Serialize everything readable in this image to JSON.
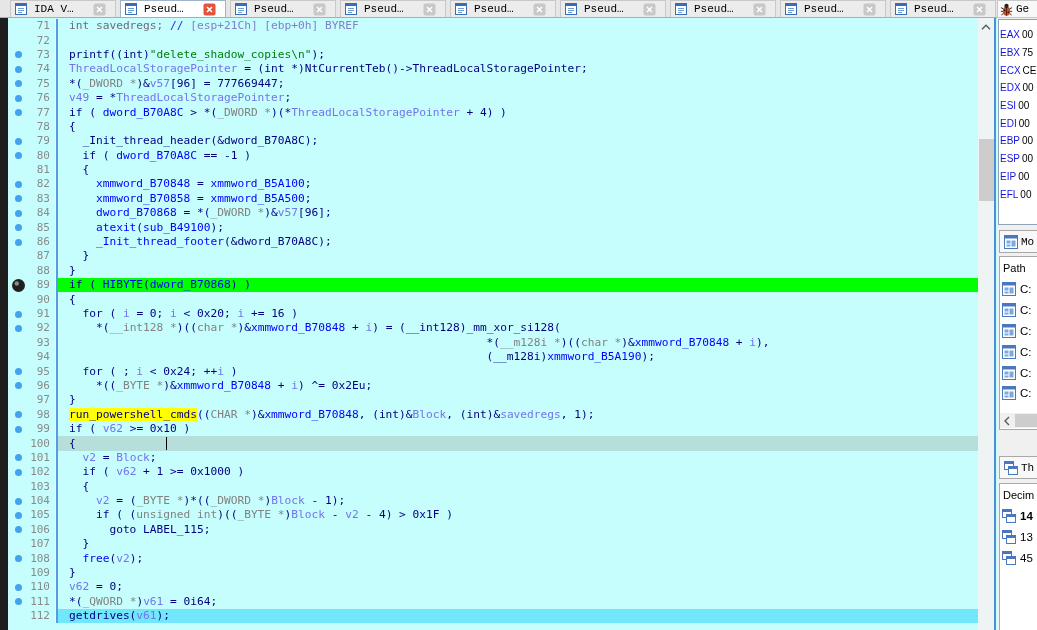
{
  "tabs": [
    {
      "label": "IDA V…",
      "selected": false
    },
    {
      "label": "Pseud…",
      "selected": true
    },
    {
      "label": "Pseud…",
      "selected": false
    },
    {
      "label": "Pseud…",
      "selected": false
    },
    {
      "label": "Pseud…",
      "selected": false
    },
    {
      "label": "Pseud…",
      "selected": false
    },
    {
      "label": "Pseud…",
      "selected": false
    },
    {
      "label": "Pseud…",
      "selected": false
    },
    {
      "label": "Pseud…",
      "selected": false
    }
  ],
  "code": {
    "lines": [
      {
        "number": "71",
        "dot": false,
        "kind": "plain",
        "tokens": [
          {
            "kind": "declaration",
            "text": "int savedregs; "
          },
          {
            "kind": "slashes",
            "text": "// "
          },
          {
            "kind": "comment",
            "text": "[esp+21Ch] [ebp+0h] BYREF"
          }
        ]
      },
      {
        "number": "72",
        "dot": false,
        "kind": "plain"
      },
      {
        "number": "73",
        "dot": true,
        "kind": "plain",
        "tokens": [
          {
            "kind": "plain",
            "text": "printf((int)"
          },
          {
            "kind": "string",
            "text": "\"delete_shadow_copies\\n\""
          },
          {
            "kind": "plain",
            "text": ");"
          }
        ]
      },
      {
        "number": "74",
        "dot": true,
        "kind": "plain",
        "tokens": [
          {
            "kind": "var",
            "text": "ThreadLocalStoragePointer"
          },
          {
            "kind": "plain",
            "text": " = (int *)NtCurrentTeb()->ThreadLocalStoragePointer;"
          }
        ]
      },
      {
        "number": "75",
        "dot": true,
        "kind": "plain",
        "tokens": [
          {
            "kind": "plain",
            "text": "*("
          },
          {
            "kind": "type",
            "text": "_DWORD *"
          },
          {
            "kind": "plain",
            "text": ")&"
          },
          {
            "kind": "var",
            "text": "v57"
          },
          {
            "kind": "plain",
            "text": "[96] = 777669447;"
          }
        ]
      },
      {
        "number": "76",
        "dot": true,
        "kind": "plain",
        "tokens": [
          {
            "kind": "var",
            "text": "v49"
          },
          {
            "kind": "plain",
            "text": " = *"
          },
          {
            "kind": "var",
            "text": "ThreadLocalStoragePointer"
          },
          {
            "kind": "plain",
            "text": ";"
          }
        ]
      },
      {
        "number": "77",
        "dot": true,
        "kind": "plain",
        "tokens": [
          {
            "kind": "plain",
            "text": "if ( "
          },
          {
            "kind": "global",
            "text": "dword_B70A8C"
          },
          {
            "kind": "plain",
            "text": " > *("
          },
          {
            "kind": "type",
            "text": "_DWORD *"
          },
          {
            "kind": "plain",
            "text": ")(*"
          },
          {
            "kind": "var",
            "text": "ThreadLocalStoragePointer"
          },
          {
            "kind": "plain",
            "text": " + 4) )"
          }
        ]
      },
      {
        "number": "78",
        "dot": false,
        "kind": "plain",
        "tokens": [
          {
            "kind": "plain",
            "text": "{"
          }
        ]
      },
      {
        "number": "79",
        "dot": true,
        "kind": "plain",
        "tokens": [
          {
            "kind": "plain",
            "text": "  _Init_thread_header(&dword_B70A8C);"
          }
        ]
      },
      {
        "number": "80",
        "dot": true,
        "kind": "plain",
        "tokens": [
          {
            "kind": "plain",
            "text": "  if ( "
          },
          {
            "kind": "global",
            "text": "dword_B70A8C"
          },
          {
            "kind": "plain",
            "text": " == -1 )"
          }
        ]
      },
      {
        "number": "81",
        "dot": false,
        "kind": "plain",
        "tokens": [
          {
            "kind": "plain",
            "text": "  {"
          }
        ]
      },
      {
        "number": "82",
        "dot": true,
        "kind": "plain",
        "tokens": [
          {
            "kind": "global",
            "text": "    xmmword_B70848"
          },
          {
            "kind": "plain",
            "text": " = "
          },
          {
            "kind": "global",
            "text": "xmmword_B5A100"
          },
          {
            "kind": "plain",
            "text": ";"
          }
        ]
      },
      {
        "number": "83",
        "dot": true,
        "kind": "plain",
        "tokens": [
          {
            "kind": "global",
            "text": "    xmmword_B70858"
          },
          {
            "kind": "plain",
            "text": " = "
          },
          {
            "kind": "global",
            "text": "xmmword_B5A500"
          },
          {
            "kind": "plain",
            "text": ";"
          }
        ]
      },
      {
        "number": "84",
        "dot": true,
        "kind": "plain",
        "tokens": [
          {
            "kind": "global",
            "text": "    dword_B70868"
          },
          {
            "kind": "plain",
            "text": " = *("
          },
          {
            "kind": "type",
            "text": "_DWORD *"
          },
          {
            "kind": "plain",
            "text": ")&"
          },
          {
            "kind": "var",
            "text": "v57"
          },
          {
            "kind": "plain",
            "text": "[96];"
          }
        ]
      },
      {
        "number": "85",
        "dot": true,
        "kind": "plain",
        "tokens": [
          {
            "kind": "global",
            "text": "    atexit"
          },
          {
            "kind": "plain",
            "text": "("
          },
          {
            "kind": "global",
            "text": "sub_B49100"
          },
          {
            "kind": "plain",
            "text": ");"
          }
        ]
      },
      {
        "number": "86",
        "dot": true,
        "kind": "plain",
        "tokens": [
          {
            "kind": "global",
            "text": "    _Init_thread_footer"
          },
          {
            "kind": "plain",
            "text": "(&dword_B70A8C);"
          }
        ]
      },
      {
        "number": "87",
        "dot": false,
        "kind": "plain",
        "tokens": [
          {
            "kind": "plain",
            "text": "  }"
          }
        ]
      },
      {
        "number": "88",
        "dot": false,
        "kind": "plain",
        "tokens": [
          {
            "kind": "plain",
            "text": "}"
          }
        ]
      },
      {
        "number": "89",
        "dot": false,
        "kind": "breakpoint",
        "tokens": [
          {
            "kind": "plain",
            "text": "if ( "
          },
          {
            "kind": "global",
            "text": "HIBYTE"
          },
          {
            "kind": "plain",
            "text": "("
          },
          {
            "kind": "global",
            "text": "dword_B70868"
          },
          {
            "kind": "plain",
            "text": ") )"
          }
        ]
      },
      {
        "number": "90",
        "dot": false,
        "kind": "plain",
        "tokens": [
          {
            "kind": "plain",
            "text": "{"
          }
        ]
      },
      {
        "number": "91",
        "dot": true,
        "kind": "plain",
        "tokens": [
          {
            "kind": "plain",
            "text": "  for ( "
          },
          {
            "kind": "var",
            "text": "i"
          },
          {
            "kind": "plain",
            "text": " = 0; "
          },
          {
            "kind": "var",
            "text": "i"
          },
          {
            "kind": "plain",
            "text": " < 0x20; "
          },
          {
            "kind": "var",
            "text": "i"
          },
          {
            "kind": "plain",
            "text": " += 16 )"
          }
        ]
      },
      {
        "number": "92",
        "dot": true,
        "kind": "plain",
        "tokens": [
          {
            "kind": "plain",
            "text": "    *("
          },
          {
            "kind": "type",
            "text": "__int128 *"
          },
          {
            "kind": "plain",
            "text": ")(("
          },
          {
            "kind": "type",
            "text": "char *"
          },
          {
            "kind": "plain",
            "text": ")&"
          },
          {
            "kind": "global",
            "text": "xmmword_B70848"
          },
          {
            "kind": "plain",
            "text": " + "
          },
          {
            "kind": "var",
            "text": "i"
          },
          {
            "kind": "plain",
            "text": ") = (__int128)_mm_xor_si128("
          }
        ]
      },
      {
        "number": "93",
        "dot": false,
        "kind": "plain",
        "tokens": [
          {
            "kind": "plain",
            "text": "                                                              *("
          },
          {
            "kind": "type",
            "text": "__m128i *"
          },
          {
            "kind": "plain",
            "text": ")(("
          },
          {
            "kind": "type",
            "text": "char *"
          },
          {
            "kind": "plain",
            "text": ")&"
          },
          {
            "kind": "global",
            "text": "xmmword_B70848"
          },
          {
            "kind": "plain",
            "text": " + "
          },
          {
            "kind": "var",
            "text": "i"
          },
          {
            "kind": "plain",
            "text": "),"
          }
        ]
      },
      {
        "number": "94",
        "dot": false,
        "kind": "plain",
        "tokens": [
          {
            "kind": "plain",
            "text": "                                                              (__m128i)"
          },
          {
            "kind": "global",
            "text": "xmmword_B5A190"
          },
          {
            "kind": "plain",
            "text": ");"
          }
        ]
      },
      {
        "number": "95",
        "dot": true,
        "kind": "plain",
        "tokens": [
          {
            "kind": "plain",
            "text": "  for ( ; "
          },
          {
            "kind": "var",
            "text": "i"
          },
          {
            "kind": "plain",
            "text": " < 0x24; ++"
          },
          {
            "kind": "var",
            "text": "i"
          },
          {
            "kind": "plain",
            "text": " )"
          }
        ]
      },
      {
        "number": "96",
        "dot": true,
        "kind": "plain",
        "tokens": [
          {
            "kind": "plain",
            "text": "    *(("
          },
          {
            "kind": "type",
            "text": "_BYTE *"
          },
          {
            "kind": "plain",
            "text": ")&"
          },
          {
            "kind": "global",
            "text": "xmmword_B70848"
          },
          {
            "kind": "plain",
            "text": " + "
          },
          {
            "kind": "var",
            "text": "i"
          },
          {
            "kind": "plain",
            "text": ") ^= 0x2Eu;"
          }
        ]
      },
      {
        "number": "97",
        "dot": false,
        "kind": "plain",
        "tokens": [
          {
            "kind": "plain",
            "text": "}"
          }
        ]
      },
      {
        "number": "98",
        "dot": true,
        "kind": "plain",
        "tokens": [
          {
            "kind": "marked",
            "text": "run_powershell_cmds"
          },
          {
            "kind": "plain",
            "text": "(("
          },
          {
            "kind": "type",
            "text": "CHAR *"
          },
          {
            "kind": "plain",
            "text": ")&"
          },
          {
            "kind": "global",
            "text": "xmmword_B70848"
          },
          {
            "kind": "plain",
            "text": ", (int)&"
          },
          {
            "kind": "var",
            "text": "Block"
          },
          {
            "kind": "plain",
            "text": ", (int)&"
          },
          {
            "kind": "var",
            "text": "savedregs"
          },
          {
            "kind": "plain",
            "text": ", 1);"
          }
        ]
      },
      {
        "number": "99",
        "dot": true,
        "kind": "plain",
        "tokens": [
          {
            "kind": "plain",
            "text": "if ( "
          },
          {
            "kind": "var",
            "text": "v62"
          },
          {
            "kind": "plain",
            "text": " >= 0x10 )"
          }
        ]
      },
      {
        "number": "100",
        "dot": false,
        "kind": "cursor",
        "tokens": [
          {
            "kind": "plain",
            "text": "{"
          }
        ]
      },
      {
        "number": "101",
        "dot": true,
        "kind": "plain",
        "tokens": [
          {
            "kind": "var",
            "text": "  v2"
          },
          {
            "kind": "plain",
            "text": " = "
          },
          {
            "kind": "var",
            "text": "Block"
          },
          {
            "kind": "plain",
            "text": ";"
          }
        ]
      },
      {
        "number": "102",
        "dot": true,
        "kind": "plain",
        "tokens": [
          {
            "kind": "plain",
            "text": "  if ( "
          },
          {
            "kind": "var",
            "text": "v62"
          },
          {
            "kind": "plain",
            "text": " + 1 >= 0x1000 )"
          }
        ]
      },
      {
        "number": "103",
        "dot": false,
        "kind": "plain",
        "tokens": [
          {
            "kind": "plain",
            "text": "  {"
          }
        ]
      },
      {
        "number": "104",
        "dot": true,
        "kind": "plain",
        "tokens": [
          {
            "kind": "var",
            "text": "    v2"
          },
          {
            "kind": "plain",
            "text": " = ("
          },
          {
            "kind": "type",
            "text": "_BYTE *"
          },
          {
            "kind": "plain",
            "text": ")*(("
          },
          {
            "kind": "type",
            "text": "_DWORD *"
          },
          {
            "kind": "plain",
            "text": ")"
          },
          {
            "kind": "var",
            "text": "Block"
          },
          {
            "kind": "plain",
            "text": " - 1);"
          }
        ]
      },
      {
        "number": "105",
        "dot": true,
        "kind": "plain",
        "tokens": [
          {
            "kind": "plain",
            "text": "    if ( ("
          },
          {
            "kind": "type",
            "text": "unsigned int"
          },
          {
            "kind": "plain",
            "text": ")(("
          },
          {
            "kind": "type",
            "text": "_BYTE *"
          },
          {
            "kind": "plain",
            "text": ")"
          },
          {
            "kind": "var",
            "text": "Block"
          },
          {
            "kind": "plain",
            "text": " - "
          },
          {
            "kind": "var",
            "text": "v2"
          },
          {
            "kind": "plain",
            "text": " - 4) > 0x1F )"
          }
        ]
      },
      {
        "number": "106",
        "dot": true,
        "kind": "plain",
        "tokens": [
          {
            "kind": "plain",
            "text": "      goto LABEL_115;"
          }
        ]
      },
      {
        "number": "107",
        "dot": false,
        "kind": "plain",
        "tokens": [
          {
            "kind": "plain",
            "text": "  }"
          }
        ]
      },
      {
        "number": "108",
        "dot": true,
        "kind": "plain",
        "tokens": [
          {
            "kind": "global",
            "text": "  free"
          },
          {
            "kind": "plain",
            "text": "("
          },
          {
            "kind": "var",
            "text": "v2"
          },
          {
            "kind": "plain",
            "text": ");"
          }
        ]
      },
      {
        "number": "109",
        "dot": false,
        "kind": "plain",
        "tokens": [
          {
            "kind": "plain",
            "text": "}"
          }
        ]
      },
      {
        "number": "110",
        "dot": true,
        "kind": "plain",
        "tokens": [
          {
            "kind": "var",
            "text": "v62"
          },
          {
            "kind": "plain",
            "text": " = 0;"
          }
        ]
      },
      {
        "number": "111",
        "dot": true,
        "kind": "plain",
        "tokens": [
          {
            "kind": "plain",
            "text": "*("
          },
          {
            "kind": "type",
            "text": "_QWORD *"
          },
          {
            "kind": "plain",
            "text": ")"
          },
          {
            "kind": "var",
            "text": "v61"
          },
          {
            "kind": "plain",
            "text": " = 0i64;"
          }
        ]
      },
      {
        "number": "112",
        "dot": false,
        "kind": "highlighted",
        "tokens": [
          {
            "kind": "plain",
            "text": "getdrives("
          },
          {
            "kind": "var",
            "text": "v61"
          },
          {
            "kind": "plain",
            "text": ");"
          }
        ]
      }
    ]
  },
  "side_panel": {
    "tab": "Ge",
    "registers": [
      {
        "name": "EAX",
        "value": "00"
      },
      {
        "name": "EBX",
        "value": "75"
      },
      {
        "name": "ECX",
        "value": "CE"
      },
      {
        "name": "EDX",
        "value": "00"
      },
      {
        "name": "ESI",
        "value": "00"
      },
      {
        "name": "EDI",
        "value": "00"
      },
      {
        "name": "EBP",
        "value": "00"
      },
      {
        "name": "ESP",
        "value": "00"
      },
      {
        "name": "EIP",
        "value": "00"
      },
      {
        "name": "EFL",
        "value": "00"
      }
    ],
    "modules": {
      "title": "Mo",
      "header": "Path",
      "rows": [
        "C:",
        "C:",
        "C:",
        "C:",
        "C:",
        "C:"
      ]
    },
    "threads": {
      "title": "Th",
      "header": "Decim",
      "rows": [
        {
          "id": "14",
          "current": true
        },
        {
          "id": "13",
          "current": false
        },
        {
          "id": "45",
          "current": false
        }
      ]
    }
  }
}
